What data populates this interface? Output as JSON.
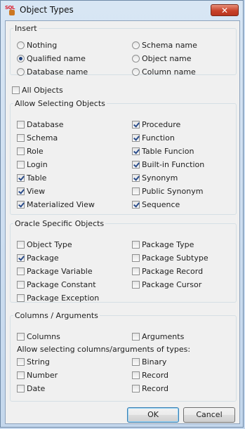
{
  "window": {
    "title": "Object Types",
    "close_glyph": "✕",
    "icon": "sql-object-icon",
    "close_color": "#c8432b"
  },
  "insert": {
    "legend": "Insert",
    "options": [
      {
        "label": "Nothing",
        "checked": false
      },
      {
        "label": "Schema name",
        "checked": false
      },
      {
        "label": "Qualified name",
        "checked": true
      },
      {
        "label": "Object name",
        "checked": false
      },
      {
        "label": "Database name",
        "checked": false
      },
      {
        "label": "Column name",
        "checked": false
      }
    ]
  },
  "all_objects": {
    "label": "All Objects",
    "checked": false
  },
  "allow": {
    "legend": "Allow Selecting Objects",
    "items": [
      {
        "label": "Database",
        "checked": false
      },
      {
        "label": "Procedure",
        "checked": true
      },
      {
        "label": "Schema",
        "checked": false
      },
      {
        "label": "Function",
        "checked": true
      },
      {
        "label": "Role",
        "checked": false
      },
      {
        "label": "Table Funcion",
        "checked": true
      },
      {
        "label": "Login",
        "checked": false
      },
      {
        "label": "Built-in Function",
        "checked": true
      },
      {
        "label": "Table",
        "checked": true
      },
      {
        "label": "Synonym",
        "checked": true
      },
      {
        "label": "View",
        "checked": true
      },
      {
        "label": "Public Synonym",
        "checked": false
      },
      {
        "label": "Materialized View",
        "checked": true
      },
      {
        "label": "Sequence",
        "checked": true
      }
    ]
  },
  "oracle": {
    "legend": "Oracle Specific Objects",
    "items": [
      {
        "label": "Object Type",
        "checked": false
      },
      {
        "label": "Package Type",
        "checked": false
      },
      {
        "label": "Package",
        "checked": true
      },
      {
        "label": "Package Subtype",
        "checked": false
      },
      {
        "label": "Package Variable",
        "checked": false
      },
      {
        "label": "Package Record",
        "checked": false
      },
      {
        "label": "Package Constant",
        "checked": false
      },
      {
        "label": "Package Cursor",
        "checked": false
      },
      {
        "label": "Package Exception",
        "checked": false
      }
    ]
  },
  "columns": {
    "legend": "Columns / Arguments",
    "columns_label": "Columns",
    "columns_checked": false,
    "arguments_label": "Arguments",
    "arguments_checked": false,
    "types_caption": "Allow selecting columns/arguments of types:",
    "types": [
      {
        "label": "String",
        "checked": false
      },
      {
        "label": "Binary",
        "checked": false
      },
      {
        "label": "Number",
        "checked": false
      },
      {
        "label": "Record",
        "checked": false
      },
      {
        "label": "Date",
        "checked": false
      },
      {
        "label": "Record",
        "checked": false
      }
    ]
  },
  "buttons": {
    "ok": "OK",
    "cancel": "Cancel"
  }
}
